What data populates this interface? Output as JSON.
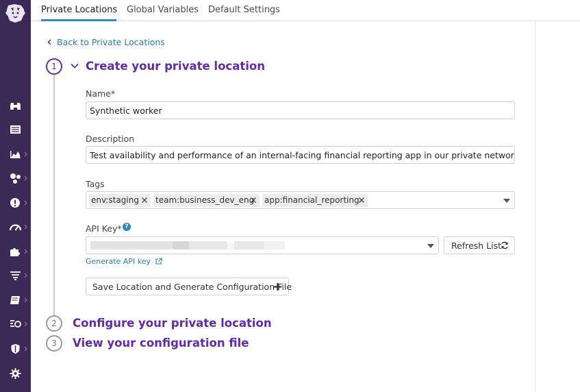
{
  "tabs": [
    {
      "label": "Private Locations",
      "active": true
    },
    {
      "label": "Global Variables",
      "active": false
    },
    {
      "label": "Default Settings",
      "active": false
    }
  ],
  "sidebar": {
    "logo": "datadog-dog-icon",
    "items": [
      {
        "icon": "binoculars-icon"
      },
      {
        "icon": "list-icon"
      },
      {
        "icon": "chart-icon"
      },
      {
        "icon": "nodes-icon"
      },
      {
        "icon": "alert-icon"
      },
      {
        "icon": "speedometer-icon"
      },
      {
        "icon": "puzzle-icon"
      },
      {
        "icon": "filter-list-icon"
      },
      {
        "icon": "book-icon"
      },
      {
        "icon": "synthetics-icon"
      },
      {
        "icon": "shield-icon"
      },
      {
        "icon": "gear-icon"
      }
    ]
  },
  "back_link": "Back to Private Locations",
  "steps": [
    {
      "number": "1",
      "title": "Create your private location",
      "expanded": true
    },
    {
      "number": "2",
      "title": "Configure your private location",
      "expanded": false
    },
    {
      "number": "3",
      "title": "View your configuration file",
      "expanded": false
    }
  ],
  "form": {
    "name_label": "Name*",
    "name_value": "Synthetic worker",
    "description_label": "Description",
    "description_value": "Test availability and performance of an internal-facing financial reporting app in our private network",
    "tags_label": "Tags",
    "tags": [
      "env:staging",
      "team:business_dev_eng",
      "app:financial_reporting"
    ],
    "api_key_label": "API Key*",
    "api_key_help": "?",
    "refresh_button": "Refresh List",
    "generate_link": "Generate API key",
    "save_button": "Save Location and Generate Configuration File"
  },
  "colors": {
    "sidebar_bg": "#3b2a55",
    "brand_purple": "#632ca6",
    "link_blue": "#2b7fb0",
    "tab_underline": "#2f8fbc"
  }
}
